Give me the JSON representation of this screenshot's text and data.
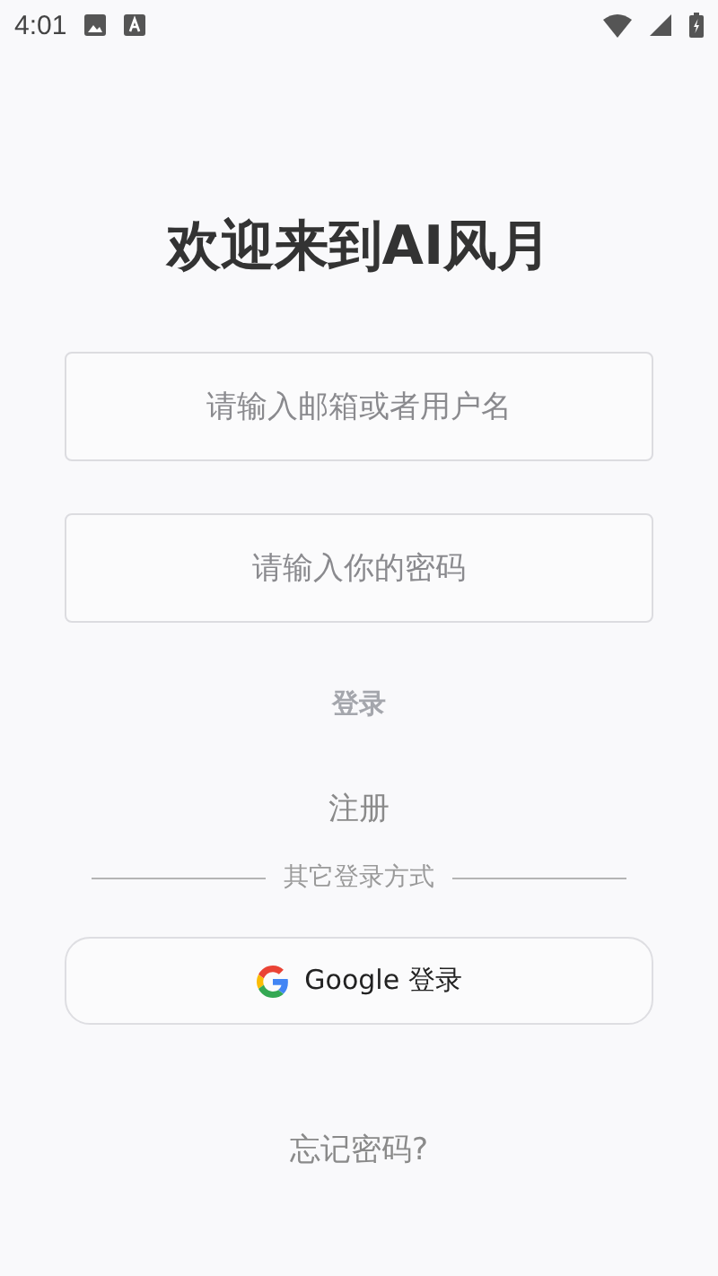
{
  "status_bar": {
    "time": "4:01"
  },
  "title": "欢迎来到AI风月",
  "fields": [
    {
      "placeholder": "请输入邮箱或者用户名"
    },
    {
      "placeholder": "请输入你的密码"
    }
  ],
  "login_button": "登录",
  "register_link": "注册",
  "divider_label": "其它登录方式",
  "google_button": "Google 登录",
  "forgot_link": "忘记密码?"
}
